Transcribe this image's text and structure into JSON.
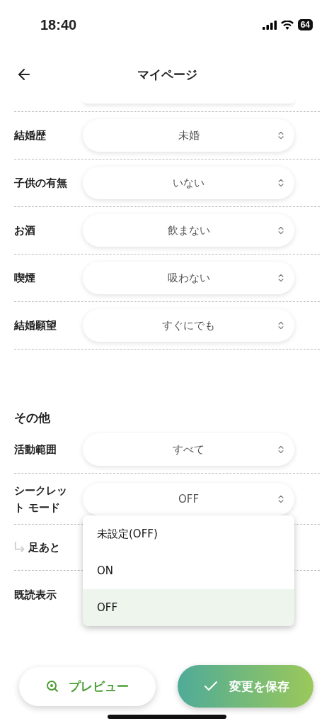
{
  "status_bar": {
    "time": "18:40",
    "battery": "64"
  },
  "header": {
    "title": "マイページ"
  },
  "profile_rows": [
    {
      "label": "結婚歴",
      "value": "未婚"
    },
    {
      "label": "子供の有無",
      "value": "いない"
    },
    {
      "label": "お酒",
      "value": "飲まない"
    },
    {
      "label": "喫煙",
      "value": "吸わない"
    },
    {
      "label": "結婚願望",
      "value": "すぐにでも"
    }
  ],
  "other_section": {
    "title": "その他",
    "rows": [
      {
        "kind": "main",
        "label": "活動範囲",
        "value": "すべて"
      },
      {
        "kind": "main",
        "label": "シークレット モード",
        "value": "OFF",
        "expanded": true,
        "options": [
          {
            "label": "未設定(OFF)",
            "selected": false
          },
          {
            "label": "ON",
            "selected": false
          },
          {
            "label": "OFF",
            "selected": true
          }
        ]
      },
      {
        "kind": "sub",
        "label": "足あと"
      },
      {
        "kind": "main",
        "label": "既読表示"
      }
    ]
  },
  "buttons": [
    {
      "kind": "secondary",
      "label": "プレビュー"
    },
    {
      "kind": "primary",
      "label": "変更を保存"
    }
  ]
}
